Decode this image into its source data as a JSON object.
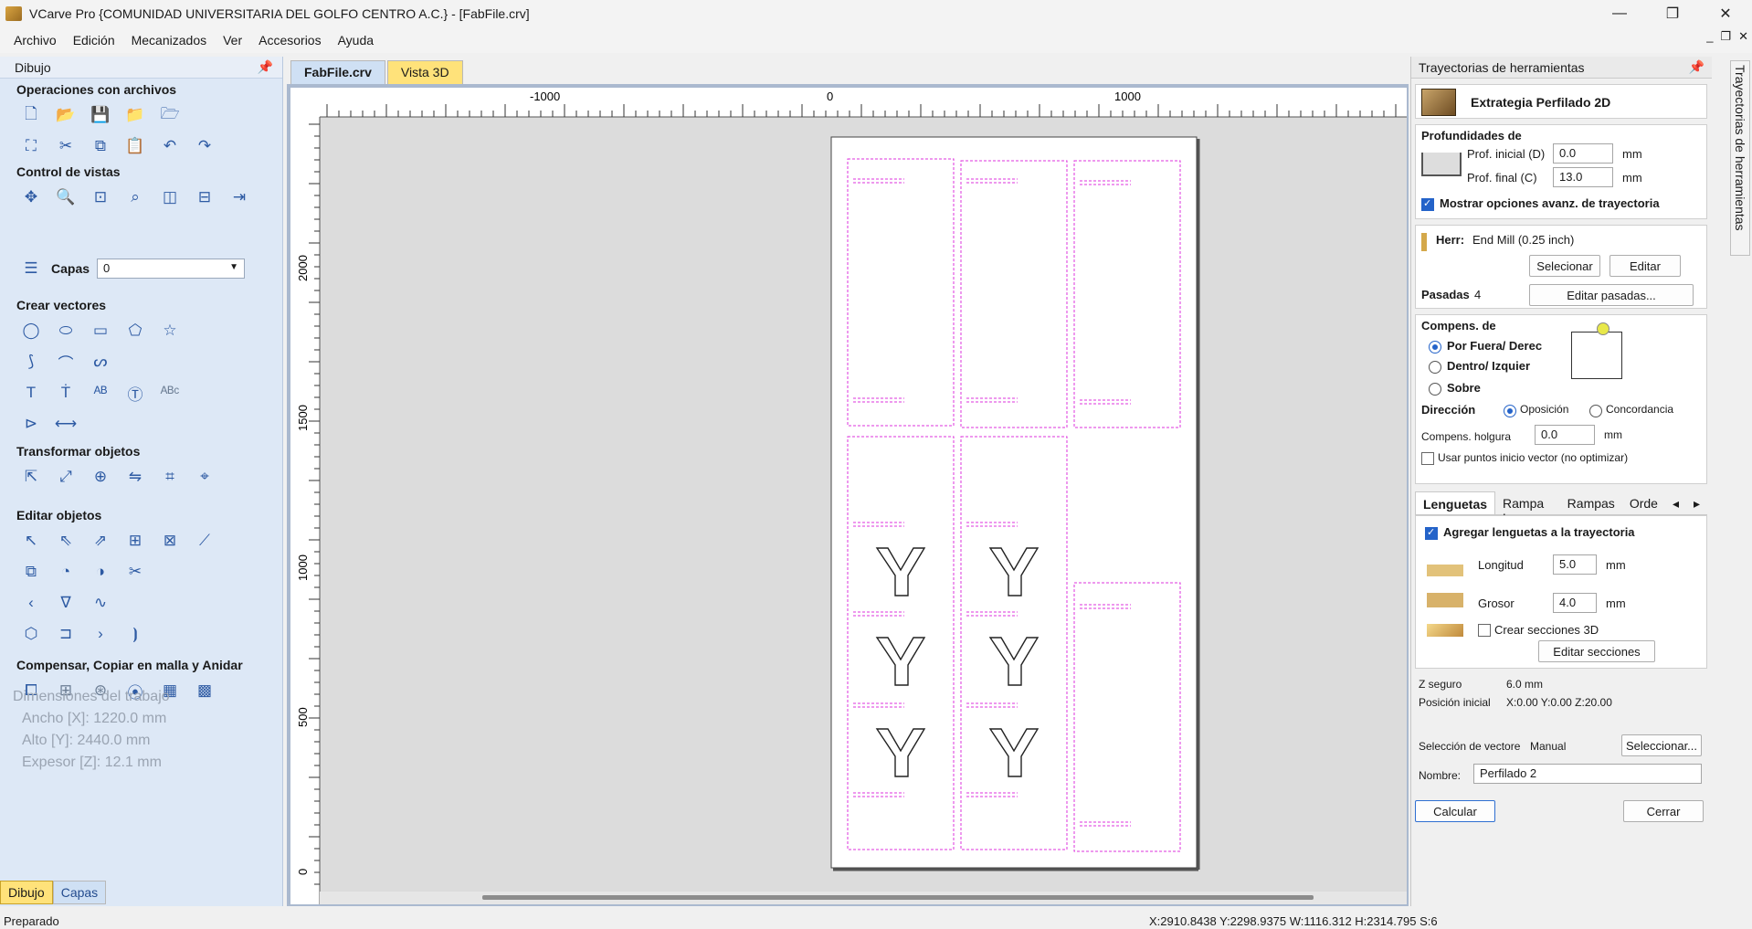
{
  "window": {
    "title": "VCarve Pro {COMUNIDAD UNIVERSITARIA DEL GOLFO CENTRO  A.C.} - [FabFile.crv]"
  },
  "menu": [
    "Archivo",
    "Edición",
    "Mecanizados",
    "Ver",
    "Accesorios",
    "Ayuda"
  ],
  "left_panel": {
    "header": "Dibujo",
    "sections": {
      "file_ops": "Operaciones con archivos",
      "view_control": "Control de vistas",
      "create_vectors": "Crear vectores",
      "transform": "Transformar objetos",
      "edit": "Editar objetos",
      "offset": "Compensar, Copiar en malla y Anidar"
    },
    "layers_label": "Capas",
    "layers_value": "0",
    "job_dims": {
      "title": "Dimensiones del trabajo",
      "width": "Ancho   [X]: 1220.0 mm",
      "height": "Alto    [Y]: 2440.0 mm",
      "thickness": "Expesor [Z]: 12.1 mm"
    },
    "tabs": [
      "Dibujo",
      "Capas"
    ]
  },
  "doc_tabs": [
    "FabFile.crv",
    "Vista 3D"
  ],
  "ruler": {
    "top_labels": [
      {
        "v": -1000,
        "text": "-1000"
      },
      {
        "v": 0,
        "text": "0"
      },
      {
        "v": 1000,
        "text": "1000"
      }
    ],
    "left_labels": [
      {
        "v": 2000,
        "text": "2000"
      },
      {
        "v": 1500,
        "text": "1500"
      },
      {
        "v": 1000,
        "text": "1000"
      },
      {
        "v": 500,
        "text": "500"
      },
      {
        "v": 0,
        "text": "0"
      }
    ]
  },
  "right_panel": {
    "header": "Trayectorias de herramientas",
    "strategy": "Extrategia Perfilado 2D",
    "depths_title": "Profundidades de",
    "start_depth_label": "Prof. inicial (D)",
    "start_depth": "0.0",
    "end_depth_label": "Prof. final (C)",
    "end_depth": "13.0",
    "unit": "mm",
    "advanced_label": "Mostrar opciones avanz. de trayectoria",
    "tool_label": "Herr:",
    "tool_name": "End Mill (0.25 inch)",
    "select_btn": "Selecionar",
    "edit_btn": "Editar",
    "passes_label": "Pasadas",
    "passes_value": "4",
    "edit_passes_btn": "Editar pasadas...",
    "offset_title": "Compens. de",
    "offset_options": [
      "Por Fuera/ Derec",
      "Dentro/ Izquier",
      "Sobre"
    ],
    "direction_label": "Dirección",
    "direction_options": [
      "Oposición",
      "Concordancia"
    ],
    "allowance_label": "Compens. holgura",
    "allowance_value": "0.0",
    "start_points_label": "Usar puntos inicio vector (no optimizar)",
    "subtabs": [
      "Lenguetas",
      "Rampa L.",
      "Rampas",
      "Orde"
    ],
    "add_tabs_label": "Agregar lenguetas a la trayectoria",
    "length_label": "Longitud",
    "length_value": "5.0",
    "thickness_label": "Grosor",
    "thickness_value": "4.0",
    "sections3d_label": "Crear secciones 3D",
    "edit_sections_btn": "Editar secciones",
    "safe_z_label": "Z seguro",
    "safe_z_value": "6.0 mm",
    "home_label": "Posición inicial",
    "home_value": "X:0.00 Y:0.00 Z:20.00",
    "vector_sel_label": "Selección de vectore",
    "vector_sel_value": "Manual",
    "select_vectors_btn": "Seleccionar...",
    "name_label": "Nombre:",
    "name_value": "Perfilado 2",
    "calc_btn": "Calcular",
    "close_btn": "Cerrar",
    "vertical_tab": "Trayectorias de herramientas"
  },
  "status": {
    "left": "Preparado",
    "right": "X:2910.8438 Y:2298.9375   W:1116.312   H:2314.795  S:6"
  },
  "colors": {
    "vector": "#dd33dd",
    "panel_blue": "#dde8f6",
    "accent_yellow": "#ffe27a"
  }
}
